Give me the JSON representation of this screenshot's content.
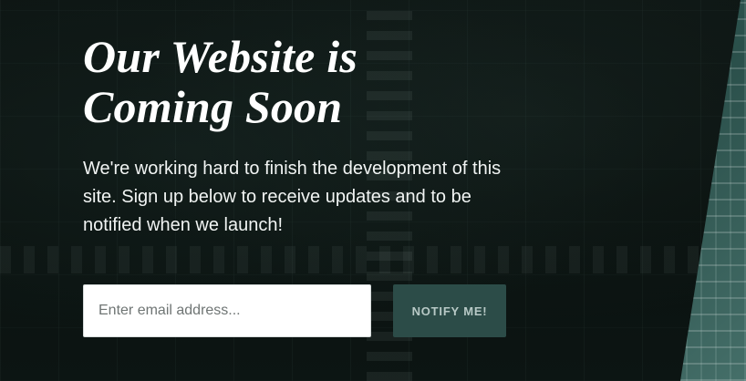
{
  "hero": {
    "title_line1": "Our Website is",
    "title_line2": "Coming Soon",
    "description": "We're working hard to finish the development of this site. Sign up below to receive updates and to be notified when we launch!"
  },
  "signup": {
    "email_placeholder": "Enter email address...",
    "button_label": "NOTIFY ME!"
  },
  "colors": {
    "background": "#0b1211",
    "button_bg": "#2c4c48",
    "button_text": "#b8c9c6",
    "accent_panel": "#3b6c66",
    "input_bg": "#ffffff"
  }
}
